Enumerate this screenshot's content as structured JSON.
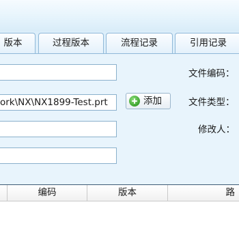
{
  "tabs": [
    {
      "label": "版本"
    },
    {
      "label": "过程版本"
    },
    {
      "label": "流程记录"
    },
    {
      "label": "引用记录"
    }
  ],
  "form": {
    "field1_value": "",
    "path_value": "ork\\NX\\NX1899-Test.prt",
    "field3_value": "",
    "field4_value": "",
    "add_button_label": "添加",
    "file_code_label": "文件编码：",
    "file_type_label": "文件类型：",
    "modifier_label": "修改人："
  },
  "table": {
    "columns": [
      "编码",
      "版本",
      "路"
    ]
  },
  "colors": {
    "accent": "#8fb8d8",
    "add_icon": "#3aa12c"
  }
}
